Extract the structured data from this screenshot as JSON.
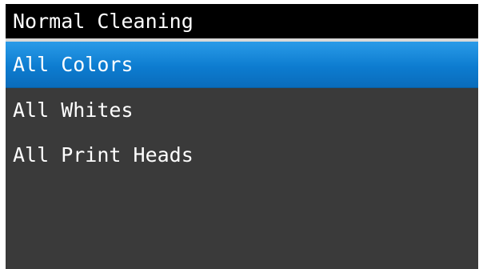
{
  "title": "Normal Cleaning",
  "menu": {
    "selected_index": 0,
    "items": [
      {
        "label": "All Colors"
      },
      {
        "label": "All Whites"
      },
      {
        "label": "All Print Heads"
      }
    ]
  },
  "colors": {
    "title_background": "#000000",
    "panel_background": "#3a3a3a",
    "selection_highlight": "#0d7cd0",
    "text": "#ffffff"
  }
}
